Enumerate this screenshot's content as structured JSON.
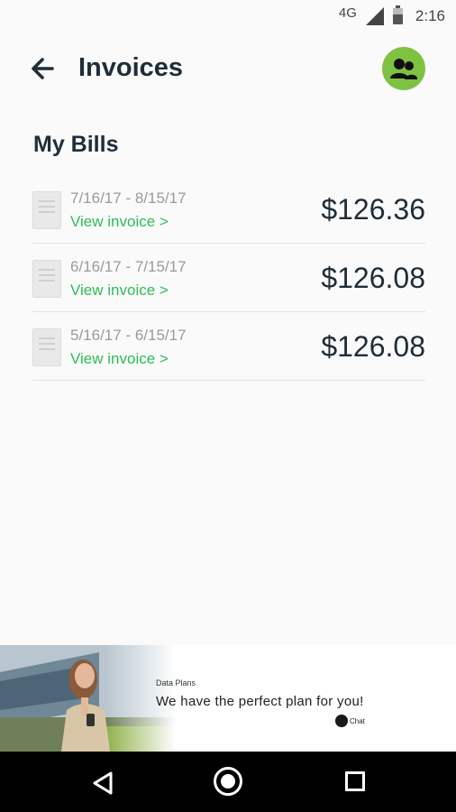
{
  "status_bar": {
    "network": "4G",
    "time": "2:16"
  },
  "app_bar": {
    "title": "Invoices"
  },
  "bills": {
    "section_title": "My Bills",
    "items": [
      {
        "dates": "7/16/17 - 8/15/17",
        "link": "View invoice >",
        "amount": "$126.36"
      },
      {
        "dates": "6/16/17 - 7/15/17",
        "link": "View invoice >",
        "amount": "$126.08"
      },
      {
        "dates": "5/16/17 - 6/15/17",
        "link": "View invoice >",
        "amount": "$126.08"
      }
    ]
  },
  "ad": {
    "kicker": "Data Plans",
    "headline": "We have the perfect plan for you!",
    "brand": "Chat"
  },
  "colors": {
    "accent_green": "#2ebd59",
    "avatar_green": "#7fc241",
    "title_dark": "#1f2d3a"
  },
  "icons": {
    "back": "arrow-left-icon",
    "account": "group-users-icon",
    "document": "document-icon",
    "nav_back": "triangle-back-icon",
    "nav_home": "circle-home-icon",
    "nav_recents": "square-recents-icon"
  }
}
